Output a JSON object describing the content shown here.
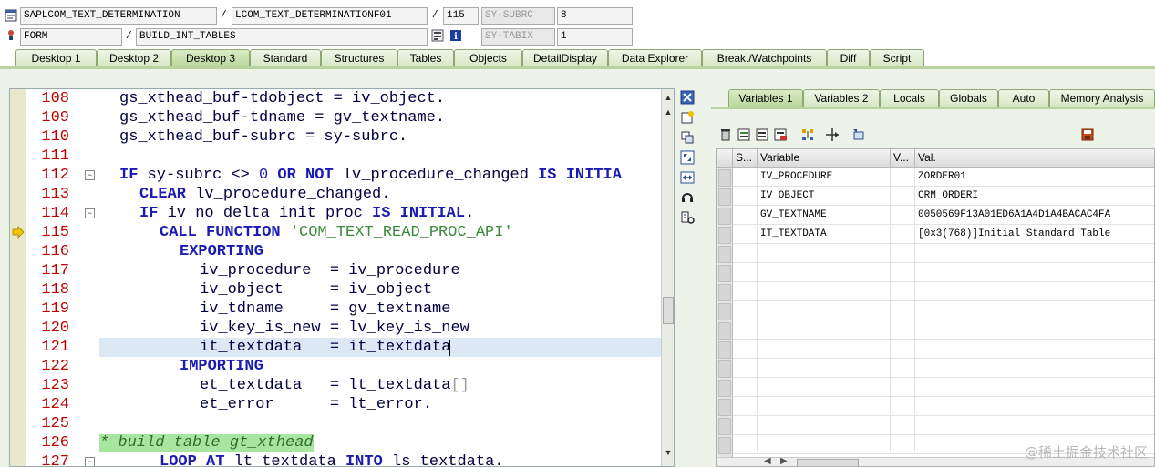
{
  "header": {
    "program": "SAPLCOM_TEXT_DETERMINATION",
    "include": "LCOM_TEXT_DETERMINATIONF01",
    "line": "115",
    "var1_name": "SY-SUBRC",
    "var1_value": "8",
    "event_type": "FORM",
    "event_name": "BUILD_INT_TABLES",
    "var2_name": "SY-TABIX",
    "var2_value": "1",
    "separator": "/"
  },
  "tabs": [
    "Desktop 1",
    "Desktop 2",
    "Desktop 3",
    "Standard",
    "Structures",
    "Tables",
    "Objects",
    "DetailDisplay",
    "Data Explorer",
    "Break./Watchpoints",
    "Diff",
    "Script"
  ],
  "active_tab": "Desktop 3",
  "code_lines": [
    {
      "n": "108"
    },
    {
      "n": "109"
    },
    {
      "n": "110"
    },
    {
      "n": "111"
    },
    {
      "n": "112"
    },
    {
      "n": "113"
    },
    {
      "n": "114"
    },
    {
      "n": "115"
    },
    {
      "n": "116"
    },
    {
      "n": "117"
    },
    {
      "n": "118"
    },
    {
      "n": "119"
    },
    {
      "n": "120"
    },
    {
      "n": "121"
    },
    {
      "n": "122"
    },
    {
      "n": "123"
    },
    {
      "n": "124"
    },
    {
      "n": "125"
    },
    {
      "n": "126"
    },
    {
      "n": "127"
    }
  ],
  "code": {
    "l108": "gs_xthead_buf-tdobject = iv_object.",
    "l109": "gs_xthead_buf-tdname = gv_textname.",
    "l110": "gs_xthead_buf-subrc = sy-subrc.",
    "l112_kw1": "IF",
    "l112_a": " sy-subrc <> ",
    "l112_num": "0",
    "l112_kw2": " OR NOT",
    "l112_b": " lv_procedure_changed ",
    "l112_kw3": "IS INITIA",
    "l113_kw": "CLEAR",
    "l113_rest": " lv_procedure_changed.",
    "l114_kw1": "IF",
    "l114_a": " iv_no_delta_init_proc ",
    "l114_kw2": "IS INITIAL",
    "l114_b": ".",
    "l115_kw": "CALL FUNCTION",
    "l115_str": " 'COM_TEXT_READ_PROC_API'",
    "l116_kw": "EXPORTING",
    "l117": "iv_procedure  = iv_procedure",
    "l118": "iv_object     = iv_object",
    "l119": "iv_tdname     = gv_textname",
    "l120": "iv_key_is_new = lv_key_is_new",
    "l121": "it_textdata   = it_textdata",
    "l122_kw": "IMPORTING",
    "l123_a": "et_textdata   = lt_textdata",
    "l123_dim": "[]",
    "l124": "et_error      = lt_error.",
    "l126_cmt": "* build table gt_xthead",
    "l127_kw1": "LOOP AT",
    "l127_a": " lt_textdata ",
    "l127_kw2": "INTO",
    "l127_b": " ls_textdata."
  },
  "right_tabs": [
    "Variables 1",
    "Variables 2",
    "Locals",
    "Globals",
    "Auto",
    "Memory Analysis"
  ],
  "right_active": "Variables 1",
  "grid": {
    "headers": {
      "s": "S...",
      "variable": "Variable",
      "v": "V...",
      "val": "Val."
    },
    "rows": [
      {
        "name": "IV_PROCEDURE",
        "val": "ZORDER01"
      },
      {
        "name": "IV_OBJECT",
        "val": "CRM_ORDERI"
      },
      {
        "name": "GV_TEXTNAME",
        "val": "0050569F13A01ED6A1A4D1A4BACAC4FA"
      },
      {
        "name": "IT_TEXTDATA",
        "val": "[0x3(768)]Initial Standard Table"
      }
    ]
  },
  "watermark": "@稀土掘金技术社区",
  "colors": {
    "tab_green": "#d5e6c4",
    "line_number": "#c00000",
    "keyword": "#1a1ab5",
    "comment_bg": "#a8e6a0",
    "current_line": "#dde8f5"
  }
}
